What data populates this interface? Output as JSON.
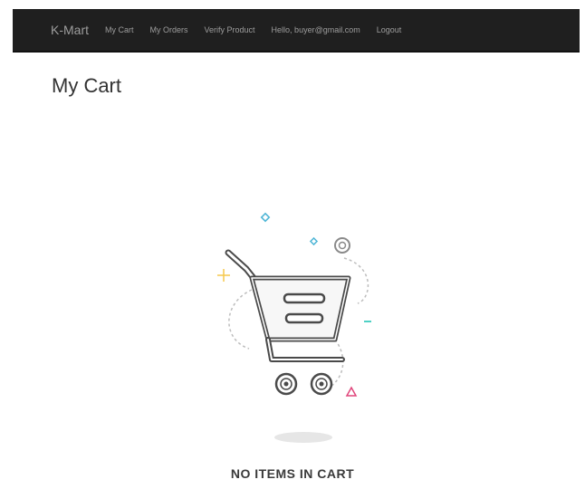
{
  "navbar": {
    "brand": "K-Mart",
    "links": [
      "My Cart",
      "My Orders",
      "Verify Product",
      "Hello, buyer@gmail.com",
      "Logout"
    ]
  },
  "page": {
    "title": "My Cart",
    "empty_message": "NO ITEMS IN CART"
  },
  "illustration": {
    "icon": "empty-cart-icon",
    "colors": {
      "outline": "#4a4a4a",
      "plus": "#f5c84c",
      "diamond": "#4fb6d6",
      "triangle": "#e0457b",
      "dash": "#4fd1c5"
    }
  }
}
